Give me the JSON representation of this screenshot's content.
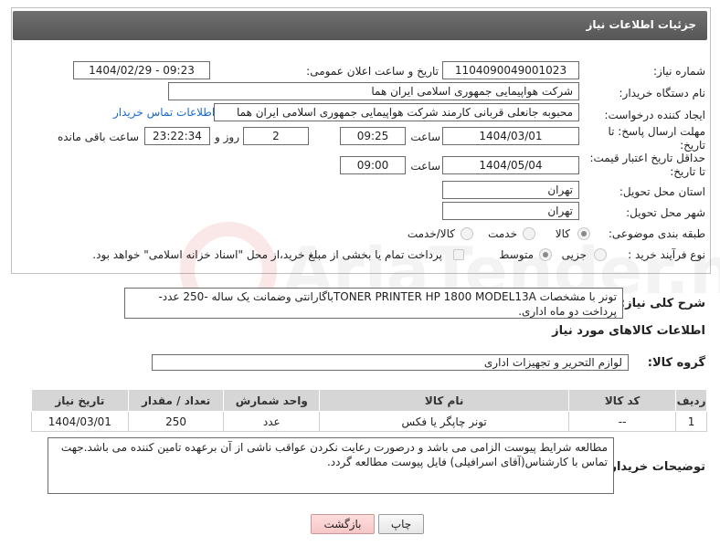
{
  "header": {
    "title": "جزئیات اطلاعات نیاز"
  },
  "form": {
    "need_number_label": "شماره نیاز:",
    "need_number": "1104090049001023",
    "announce_datetime_label": "تاریخ و ساعت اعلان عمومی:",
    "announce_datetime": "1404/02/29 - 09:23",
    "buyer_org_label": "نام دستگاه خریدار:",
    "buyer_org": "شرکت هواپیمایی جمهوری اسلامی ایران هما",
    "requester_label": "ایجاد کننده درخواست:",
    "requester": "محبوبه جانعلی قربانی کارمند شرکت هواپیمایی جمهوری اسلامی ایران هما",
    "buyer_contact_link": "اطلاعات تماس خریدار",
    "reply_deadline_label_1": "مهلت ارسال پاسخ: تا",
    "reply_deadline_label_2": "تاریخ:",
    "reply_date": "1404/03/01",
    "time_label": "ساعت",
    "reply_time": "09:25",
    "days_value": "2",
    "days_label": "روز و",
    "remaining_time": "23:22:34",
    "remaining_label": "ساعت باقی مانده",
    "price_validity_label_1": "حداقل تاریخ اعتبار قیمت:",
    "price_validity_label_2": "تا تاریخ:",
    "validity_date": "1404/05/04",
    "validity_time": "09:00",
    "province_label": "استان محل تحویل:",
    "province": "تهران",
    "city_label": "شهر محل تحویل:",
    "city": "تهران",
    "category_label": "طبقه بندی موضوعی:",
    "category_options": [
      "کالا",
      "خدمت",
      "کالا/خدمت"
    ],
    "category_selected": "کالا",
    "process_label": "نوع فرآیند خرید :",
    "process_options": [
      "جزیی",
      "متوسط"
    ],
    "process_selected": "متوسط",
    "payment_note": "پرداخت تمام یا بخشی از مبلغ خرید،از محل \"اسناد خزانه اسلامی\" خواهد بود."
  },
  "description": {
    "label": "شرح کلی نیاز:",
    "text": "تونر با مشخصات TONER PRINTER HP 1800 MODEL13Aباگارانتی وضمانت یک ساله -250 عدد-پرداخت دو ماه اداری."
  },
  "goods_section": {
    "title": "اطلاعات کالاهای مورد نیاز",
    "group_label": "گروه کالا:",
    "group_value": "لوازم التحریر و تجهیزات اداری",
    "columns": [
      "ردیف",
      "کد کالا",
      "نام کالا",
      "واحد شمارش",
      "تعداد / مقدار",
      "تاریخ نیاز"
    ],
    "rows": [
      {
        "row": "1",
        "code": "--",
        "name": "تونر چاپگر یا فکس",
        "unit": "عدد",
        "qty": "250",
        "date": "1404/03/01"
      }
    ]
  },
  "buyer_notes": {
    "label": "توضیحات خریدار:",
    "text": "مطالعه شرایط پیوست الزامی می باشد و درصورت رعایت نکردن عواقب ناشی از آن برعهده تامین کننده می باشد.جهت تماس با کارشناس(آقای اسرافیلی) فایل پیوست مطالعه گردد."
  },
  "buttons": {
    "print": "چاپ",
    "back": "بازگشت"
  },
  "colors": {
    "header": "#5f5f5f",
    "link": "#1b6ac9",
    "table_header": "#d6d6d6",
    "back_button": "#f6c6c6"
  }
}
